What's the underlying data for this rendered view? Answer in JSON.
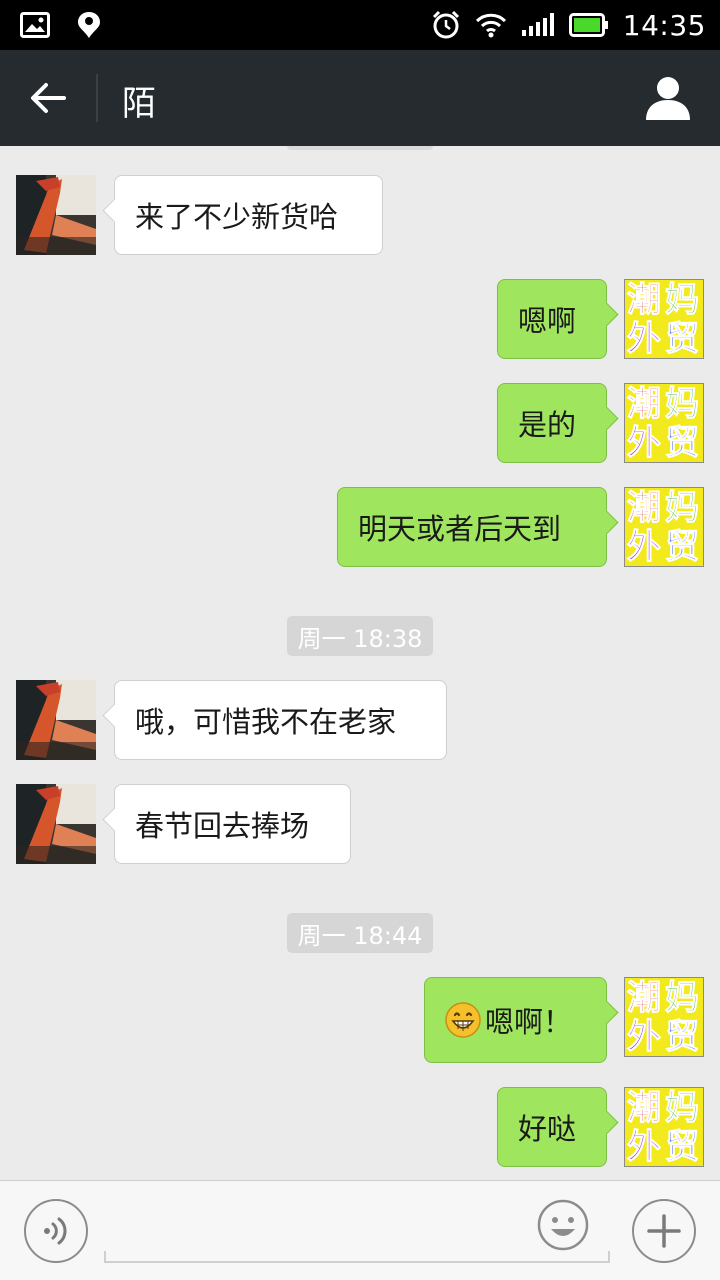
{
  "status_bar": {
    "time": "14:35"
  },
  "header": {
    "title": "陌"
  },
  "messages": [
    {
      "side": "in",
      "text": "来了不少新货哈"
    },
    {
      "side": "out",
      "text": "嗯啊"
    },
    {
      "side": "out",
      "text": "是的"
    },
    {
      "side": "out",
      "text": "明天或者后天到"
    },
    {
      "side": "ts",
      "text": "周一 18:38"
    },
    {
      "side": "in",
      "text": "哦，可惜我不在老家"
    },
    {
      "side": "in",
      "text": "春节回去捧场"
    },
    {
      "side": "ts",
      "text": "周一 18:44"
    },
    {
      "side": "out",
      "emoji": "grinning-face-icon",
      "text": "嗯啊！"
    },
    {
      "side": "out",
      "text": "好哒"
    }
  ],
  "self_avatar_text": [
    "潮",
    "妈",
    "外",
    "贸"
  ],
  "colors": {
    "out_bubble": "#9fe65e",
    "in_bubble": "#ffffff",
    "header_bg": "#252b2e",
    "chat_bg": "#ebebeb"
  },
  "input": {
    "value": "",
    "placeholder": ""
  }
}
